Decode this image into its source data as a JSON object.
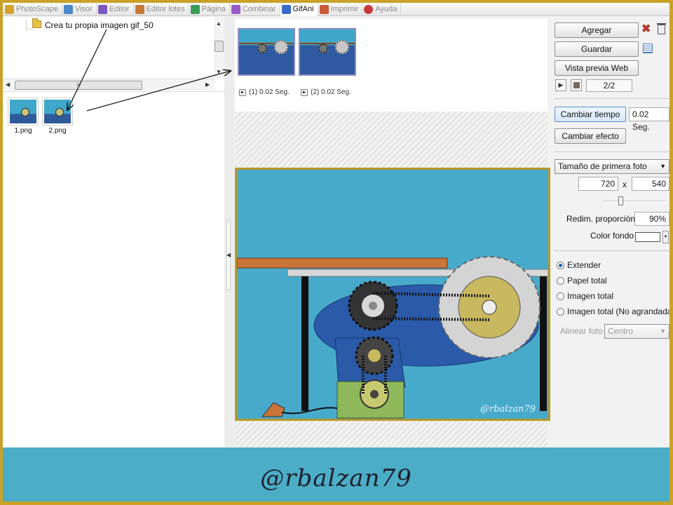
{
  "tabs": [
    {
      "label": "PhotoScape",
      "color": "#d6a32c",
      "active": false
    },
    {
      "label": "Visor",
      "color": "#4a89c8",
      "active": false
    },
    {
      "label": "Editor",
      "color": "#7a5ac0",
      "active": false
    },
    {
      "label": "Editor lotes",
      "color": "#c87a3a",
      "active": false
    },
    {
      "label": "Página",
      "color": "#3a9c5a",
      "active": false
    },
    {
      "label": "Combinar",
      "color": "#9a5ac8",
      "active": false
    },
    {
      "label": "GifAni",
      "color": "#3a6ac8",
      "active": true
    },
    {
      "label": "Imprimir",
      "color": "#c85a3a",
      "active": false
    },
    {
      "label": "Ayuda",
      "color": "#c83a3a",
      "active": false
    }
  ],
  "tree": {
    "folder_label": "Crea tu propia imagen gif_50",
    "scroll_grip": "III"
  },
  "files": [
    {
      "name": "1.png"
    },
    {
      "name": "2.png"
    }
  ],
  "frames": [
    {
      "label": "(1) 0.02 Seg."
    },
    {
      "label": "(2) 0.02 Seg."
    }
  ],
  "preview": {
    "watermark": "@rbalzan79"
  },
  "controls": {
    "add_label": "Agregar",
    "save_label": "Guardar",
    "web_preview_label": "Vista previa Web",
    "frame_counter": "2/2",
    "change_time_label": "Cambiar tiempo",
    "time_value": "0.02 Seg.",
    "change_effect_label": "Cambiar efecto",
    "size_mode": "Tamaño de primera foto",
    "width": "720",
    "times": "x",
    "height": "540",
    "resize_ratio_label": "Redim. proporción",
    "resize_ratio_value": "90%",
    "bg_color_label": "Color fondo",
    "bg_color": "#ffffff",
    "radio_options": [
      {
        "label": "Extender",
        "checked": true
      },
      {
        "label": "Papel total",
        "checked": false
      },
      {
        "label": "Imagen total",
        "checked": false
      },
      {
        "label": "Imagen total (No agrandada)",
        "checked": false
      }
    ],
    "align_label": "Alinear foto",
    "align_value": "Centro"
  },
  "banner": {
    "text": "@rbalzan79"
  }
}
